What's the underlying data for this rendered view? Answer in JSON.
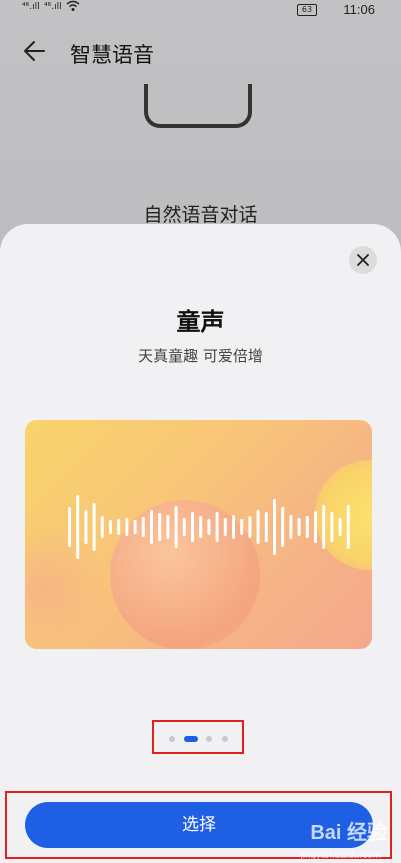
{
  "status_bar": {
    "signal_1": "⁴⁶.ıll",
    "signal_2": "⁴⁶.ıll",
    "battery": "63",
    "time": "11:06"
  },
  "header": {
    "title": "智慧语音"
  },
  "background": {
    "feature_text": "自然语音对话"
  },
  "sheet": {
    "voice_title": "童声",
    "voice_subtitle": "天真童趣 可爱倍增",
    "pager": {
      "count": 4,
      "active_index": 1
    },
    "select_label": "选择"
  },
  "watermark": {
    "brand": "Bai 经验",
    "url": "jingyan.baidu.com"
  },
  "colors": {
    "accent": "#1f5fe3",
    "highlight": "#e02020"
  },
  "icons": {
    "back": "arrow-left-icon",
    "close": "close-icon",
    "wifi": "wifi-icon",
    "waveform": "waveform-icon"
  }
}
